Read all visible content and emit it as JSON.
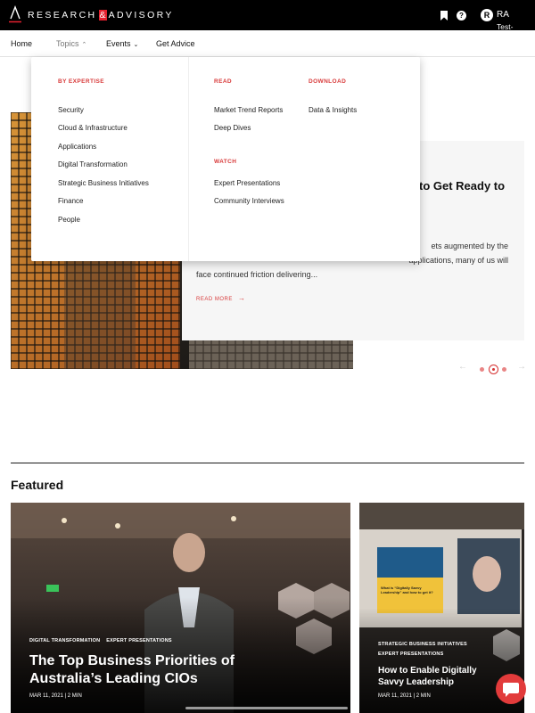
{
  "brand": {
    "name_left": "RESEARCH",
    "amp": "&",
    "name_right": "ADVISORY"
  },
  "header": {
    "user_initial": "R",
    "user_name": "RA",
    "user_sub": "Test-"
  },
  "nav": {
    "home": "Home",
    "topics": "Topics",
    "events": "Events",
    "get_advice": "Get Advice"
  },
  "topics_menu": {
    "by_expertise_heading": "BY EXPERTISE",
    "by_expertise": [
      "Security",
      "Cloud & Infrastructure",
      "Applications",
      "Digital Transformation",
      "Strategic Business Initiatives",
      "Finance",
      "People"
    ],
    "read_heading": "READ",
    "read": [
      "Market Trend Reports",
      "Deep Dives"
    ],
    "watch_heading": "WATCH",
    "watch": [
      "Expert Presentations",
      "Community Interviews"
    ],
    "download_heading": "DOWNLOAD",
    "download": [
      "Data & Insights"
    ]
  },
  "hero": {
    "title_visible": "to Get Ready to",
    "desc_line1": "ets augmented by the",
    "desc_line2": "face continued friction delivering...",
    "desc_line2_right": "applications, many of us will",
    "read_more": "READ MORE",
    "carousel": {
      "slides": 3,
      "active": 2
    }
  },
  "featured": {
    "heading": "Featured",
    "cards": [
      {
        "tags": [
          "DIGITAL TRANSFORMATION",
          "EXPERT PRESENTATIONS"
        ],
        "title_line1": "The Top Business Priorities of",
        "title_line2": "Australia’s Leading CIOs",
        "meta": "MAR 11, 2021 | 2 MIN"
      },
      {
        "tags": [
          "STRATEGIC BUSINESS INITIATIVES",
          "EXPERT PRESENTATIONS"
        ],
        "title_line1": "How to Enable Digitally",
        "title_line2": "Savvy Leadership",
        "meta": "MAR 11, 2021 | 2 MIN",
        "screen_text": "What is “Digitally Savvy Leadership” and how to get it?"
      }
    ]
  },
  "colors": {
    "accent": "#d83a3a",
    "topbar": "#000000"
  }
}
